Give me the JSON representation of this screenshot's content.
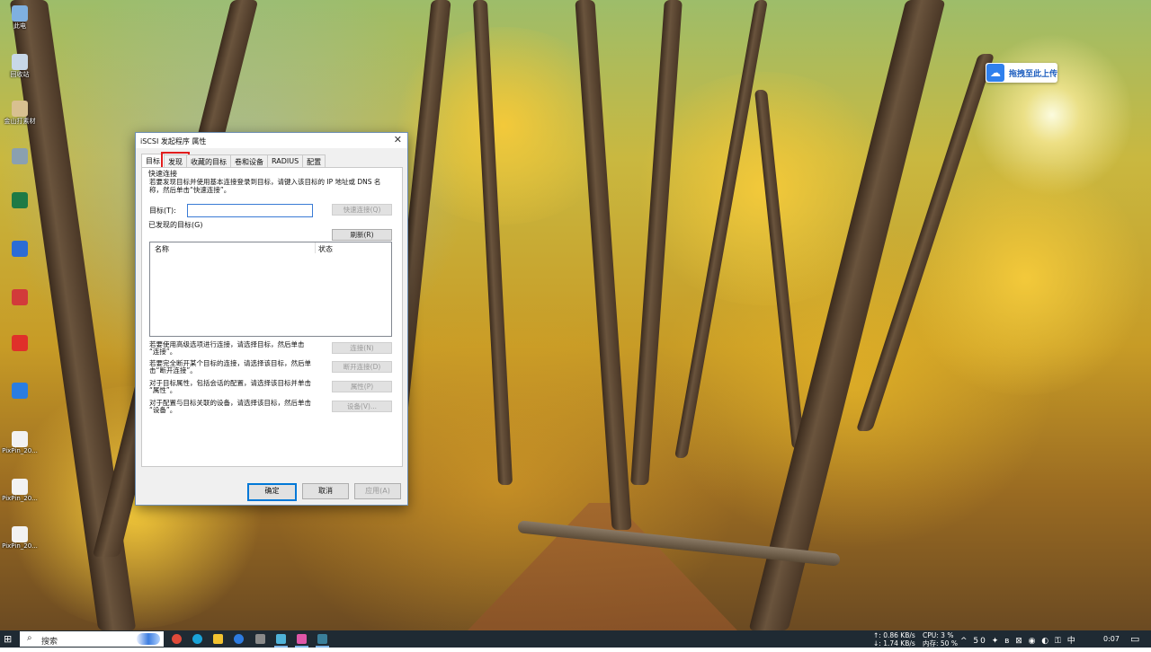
{
  "desktop": {
    "icons": [
      {
        "label": "此电",
        "icon": "computer-icon",
        "color": "#7fb0e0"
      },
      {
        "label": "回收站",
        "icon": "recycle-bin-icon",
        "color": "#c8d8e8"
      },
      {
        "label": "金山打素材",
        "icon": "app-icon",
        "color": "#d8c090"
      },
      {
        "label": "",
        "icon": "blurred-icon",
        "color": "#8aa0b0"
      },
      {
        "label": "",
        "icon": "excel-icon",
        "color": "#1e7a45"
      },
      {
        "label": "",
        "icon": "word-icon",
        "color": "#2b6cd6"
      },
      {
        "label": "",
        "icon": "app-red-icon",
        "color": "#d23a3a"
      },
      {
        "label": "",
        "icon": "app-red2-icon",
        "color": "#e0302a"
      },
      {
        "label": "",
        "icon": "app-blue-icon",
        "color": "#2a7de1"
      },
      {
        "label": "PixPin_20...",
        "icon": "image-file-icon",
        "color": "#f2f2f2"
      },
      {
        "label": "PixPin_20...",
        "icon": "image-file-icon",
        "color": "#f2f2f2"
      },
      {
        "label": "PixPin_20...",
        "icon": "image-file-icon",
        "color": "#f2f2f2"
      }
    ],
    "upload_badge": {
      "label": "拖拽至此上传",
      "icon": "cloud-upload-icon"
    }
  },
  "dialog": {
    "title": "iSCSI 发起程序 属性",
    "close": "✕",
    "tabs": [
      {
        "label": "目标",
        "active": true
      },
      {
        "label": "发现",
        "highlighted": true
      },
      {
        "label": "收藏的目标"
      },
      {
        "label": "卷和设备"
      },
      {
        "label": "RADIUS"
      },
      {
        "label": "配置"
      }
    ],
    "quick_connect": {
      "group_label": "快速连接",
      "description_line1": "若要发现目标并使用基本连接登录到目标，请键入该目标的 IP 地址或 DNS 名",
      "description_line2": "称，然后单击“快速连接”。",
      "target_label": "目标(T):",
      "target_value": "",
      "button": "快速连接(Q)"
    },
    "discovered": {
      "group_label": "已发现的目标(G)",
      "refresh_button": "刷新(R)",
      "columns": [
        "名称",
        "状态"
      ],
      "rows": []
    },
    "actions": [
      {
        "text_line1": "若要使用高级选项进行连接，请选择目标，然后单击",
        "text_line2": "“连接”。",
        "button": "连接(N)"
      },
      {
        "text_line1": "若要完全断开某个目标的连接，请选择该目标，然后单",
        "text_line2": "击“断开连接”。",
        "button": "断开连接(D)"
      },
      {
        "text_line1": "对于目标属性，包括会话的配置，请选择该目标并单击",
        "text_line2": "“属性”。",
        "button": "属性(P)"
      },
      {
        "text_line1": "对于配置与目标关联的设备，请选择该目标，然后单击",
        "text_line2": "“设备”。",
        "button": "设备(V)..."
      }
    ],
    "footer": {
      "ok": "确定",
      "cancel": "取消",
      "apply": "应用(A)"
    }
  },
  "taskbar": {
    "search_placeholder": "搜索",
    "apps": [
      {
        "icon": "chrome-icon",
        "color": "#e04a3a"
      },
      {
        "icon": "edge-icon",
        "color": "#1aa3d8"
      },
      {
        "icon": "file-explorer-icon",
        "color": "#f2c230"
      },
      {
        "icon": "app-blue-circle-icon",
        "color": "#2d7be0"
      },
      {
        "icon": "terminal-icon",
        "color": "#8a8a8a"
      },
      {
        "icon": "app-teal-icon",
        "color": "#4fb3d9"
      },
      {
        "icon": "app-pink-icon",
        "color": "#e056a8"
      },
      {
        "icon": "app-dark-icon",
        "color": "#3a7f9a"
      }
    ],
    "net_up": "↑: 0.86 KB/s",
    "net_down": "↓: 1.74 KB/s",
    "cpu": "CPU: 3 %",
    "mem": "内存: 50 %",
    "tray_icons": "^ 50 ✦ ʙ ⊠ ◉ ◐ ⚿ 中",
    "time": "0:07",
    "notification": "▭"
  }
}
